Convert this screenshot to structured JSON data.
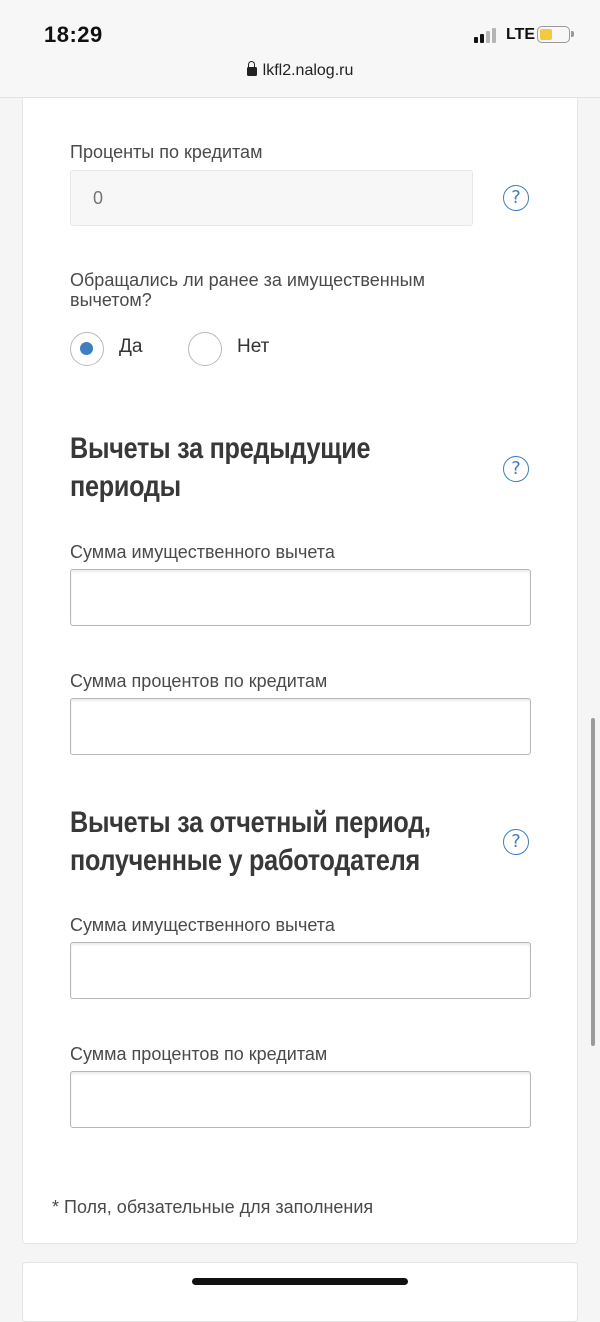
{
  "status_bar": {
    "time": "18:29",
    "network": "LTE",
    "signal_bars_active": 2,
    "signal_bars_total": 4,
    "battery_level": 0.45,
    "battery_color": "#f5c842"
  },
  "browser": {
    "url": "lkfl2.nalog.ru"
  },
  "form": {
    "credit_interest": {
      "label": "Проценты по кредитам",
      "value": "0",
      "disabled": true
    },
    "previous_deduction": {
      "question_line1": "Обращались ли ранее за имущественным",
      "question_line2": "вычетом?",
      "options": [
        {
          "label": "Да",
          "selected": true
        },
        {
          "label": "Нет",
          "selected": false
        }
      ]
    },
    "section_previous": {
      "title_line1": "Вычеты за предыдущие",
      "title_line2": "периоды",
      "property_label": "Сумма имущественного вычета",
      "property_value": "",
      "interest_label": "Сумма процентов по кредитам",
      "interest_value": ""
    },
    "section_employer": {
      "title_line1": "Вычеты за отчетный период,",
      "title_line2": "полученные у работодателя",
      "property_label": "Сумма имущественного вычета",
      "property_value": "",
      "interest_label": "Сумма процентов по кредитам",
      "interest_value": ""
    },
    "help_symbol": "?",
    "footnote": "* Поля, обязательные для заполнения"
  },
  "colors": {
    "accent": "#3f7ec1"
  }
}
